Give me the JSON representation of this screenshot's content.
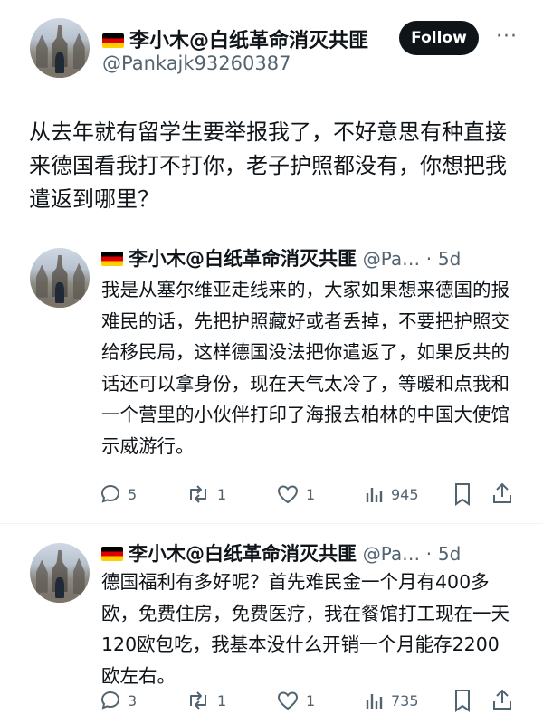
{
  "author": {
    "display_name": "李小木@白纸革命消灭共匪",
    "handle": "@Pankajk93260387",
    "flag_icon": "german-flag-icon"
  },
  "header": {
    "follow_label": "Follow",
    "more_label": "···"
  },
  "main_tweet": {
    "text": "从去年就有留学生要举报我了，不好意思有种直接来德国看我打不打你，老子护照都没有，你想把我遣返到哪里？"
  },
  "replies": [
    {
      "display_name": "李小木@白纸革命消灭共匪",
      "handle": "@Pa…",
      "sep": "·",
      "time": "5d",
      "text": "我是从塞尔维亚走线来的，大家如果想来德国的报难民的话，先把护照藏好或者丢掉，不要把护照交给移民局，这样德国没法把你遣返了，如果反共的话还可以拿身份，现在天气太冷了，等暖和点我和一个营里的小伙伴打印了海报去柏林的中国大使馆示威游行。",
      "replies_count": "5",
      "retweets_count": "1",
      "likes_count": "1",
      "views_count": "945"
    },
    {
      "display_name": "李小木@白纸革命消灭共匪",
      "handle": "@Pa…",
      "sep": "·",
      "time": "5d",
      "text": "德国福利有多好呢？首先难民金一个月有400多欧，免费住房，免费医疗，我在餐馆打工现在一天120欧包吃，我基本没什么开销一个月能存2200欧左右。",
      "replies_count": "3",
      "retweets_count": "1",
      "likes_count": "1",
      "views_count": "735"
    }
  ],
  "colors": {
    "text": "#0f1419",
    "secondary": "#536471",
    "follow_bg": "#0f1419",
    "follow_text": "#ffffff"
  }
}
